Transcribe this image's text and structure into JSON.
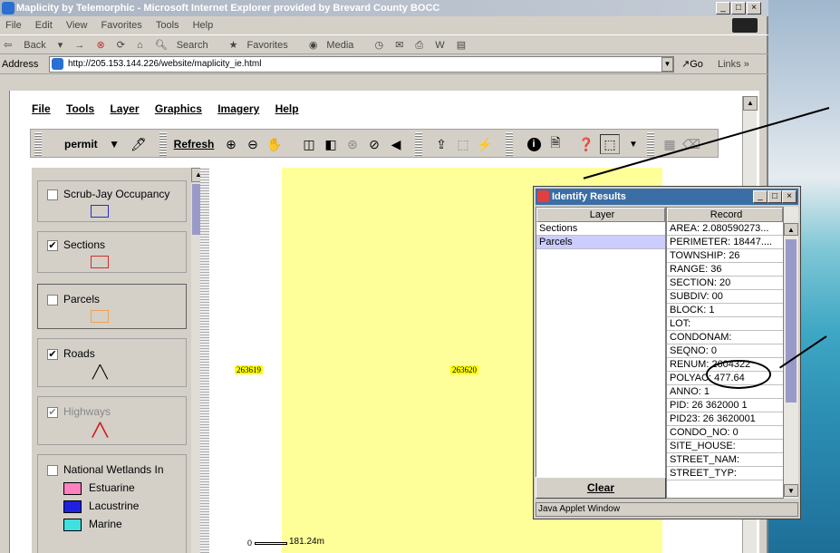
{
  "window": {
    "title": "Maplicity by Telemorphic - Microsoft Internet Explorer provided by Brevard County BOCC",
    "controls": [
      "_",
      "□",
      "×"
    ]
  },
  "ie_menu": [
    "File",
    "Edit",
    "View",
    "Favorites",
    "Tools",
    "Help"
  ],
  "ie_toolbar": [
    "Back",
    "→",
    "Search",
    "Favorites",
    "Media"
  ],
  "address": {
    "label": "Address",
    "url": "http://205.153.144.226/website/maplicity_ie.html",
    "go": "Go",
    "links": "Links »"
  },
  "app_menu": [
    "File",
    "Tools",
    "Layer",
    "Graphics",
    "Imagery",
    "Help"
  ],
  "app_toolbar": {
    "layer_selected": "permit",
    "refresh": "Refresh"
  },
  "legend": [
    {
      "name": "Scrub-Jay Occupancy",
      "checked": false,
      "color": "#2b2bd0"
    },
    {
      "name": "Sections",
      "checked": true,
      "color": "#d03030"
    },
    {
      "name": "Parcels",
      "checked": false,
      "color": "#f0a050"
    },
    {
      "name": "Roads",
      "checked": true,
      "color": "#000000"
    },
    {
      "name": "Highways",
      "checked": true,
      "color": "#d02020"
    },
    {
      "name": "National Wetlands In",
      "checked": false
    },
    {
      "name": "Estuarine",
      "color": "#ff80c0"
    },
    {
      "name": "Lacustrine",
      "color": "#2020e0"
    },
    {
      "name": "Marine",
      "color": "#40e0e0"
    }
  ],
  "map": {
    "labels": [
      "263619",
      "263620"
    ],
    "scale": "181.24m",
    "scale_zero": "0"
  },
  "identify": {
    "title": "Identify Results",
    "layer_header": "Layer",
    "record_header": "Record",
    "layers": [
      "Sections",
      "Parcels"
    ],
    "records": [
      "AREA: 2.080590273...",
      "PERIMETER: 18447....",
      "TOWNSHIP: 26",
      "RANGE: 36",
      "SECTION: 20",
      "SUBDIV: 00",
      "BLOCK: 1",
      "LOT:",
      "CONDONAM:",
      "SEQNO: 0",
      "RENUM: 2604322",
      "POLYAC: 477.64",
      "ANNO: 1",
      "PID: 26 362000   1",
      "PID23: 26 3620001",
      "CONDO_NO: 0",
      "SITE_HOUSE:",
      "STREET_NAM:",
      "STREET_TYP:"
    ],
    "clear": "Clear",
    "status": "Java Applet Window"
  }
}
